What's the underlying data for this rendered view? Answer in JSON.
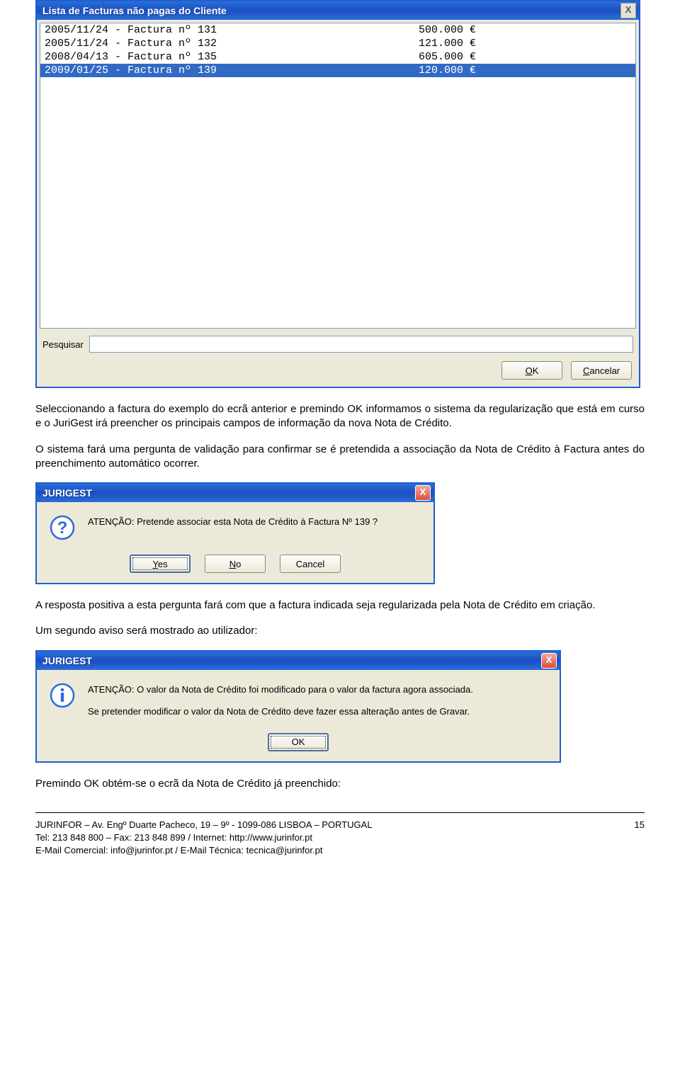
{
  "list_window": {
    "title": "Lista de Facturas não pagas do Cliente",
    "close": "X",
    "rows": [
      {
        "left": "2005/11/24 - Factura nº 131",
        "right": "500.000 €",
        "selected": false
      },
      {
        "left": "2005/11/24 - Factura nº 132",
        "right": "121.000 €",
        "selected": false
      },
      {
        "left": "2008/04/13 - Factura nº 135",
        "right": "605.000 €",
        "selected": false
      },
      {
        "left": "2009/01/25 - Factura nº 139",
        "right": "120.000 €",
        "selected": true
      }
    ],
    "search_label": "Pesquisar",
    "search_value": "",
    "ok_label": "OK",
    "cancel_label": "Cancelar"
  },
  "para1": "Seleccionando a factura do exemplo do ecrã anterior e premindo OK informamos o sistema da regularização que está em curso e o JuriGest irá preencher os principais campos de informação da nova Nota de Crédito.",
  "para2": "O sistema fará uma pergunta de validação para confirmar se é pretendida a associação da Nota de Crédito à Factura antes do preenchimento automático ocorrer.",
  "dialog1": {
    "title": "JURIGEST",
    "close": "X",
    "message": "ATENÇÃO: Pretende associar esta Nota de Crédito à Factura Nº 139 ?",
    "yes": "Yes",
    "no": "No",
    "cancel": "Cancel"
  },
  "para3": "A resposta positiva a esta pergunta fará com que a factura indicada seja regularizada pela Nota de Crédito em criação.",
  "para4": "Um segundo aviso será mostrado ao utilizador:",
  "dialog2": {
    "title": "JURIGEST",
    "close": "X",
    "line1": "ATENÇÃO: O valor da Nota de Crédito foi modificado para o valor da factura agora associada.",
    "line2": "Se pretender modificar o valor da Nota de Crédito deve fazer essa alteração antes de Gravar.",
    "ok": "OK"
  },
  "para5": "Premindo OK obtém-se o ecrã da Nota de Crédito já preenchido:",
  "footer": {
    "line1": "JURINFOR – Av. Engº Duarte Pacheco, 19 – 9º - 1099-086 LISBOA – PORTUGAL",
    "line2": "Tel: 213 848 800 – Fax: 213 848 899 / Internet: http://www.jurinfor.pt",
    "line3": "E-Mail Comercial: info@jurinfor.pt / E-Mail Técnica: tecnica@jurinfor.pt",
    "page": "15"
  }
}
